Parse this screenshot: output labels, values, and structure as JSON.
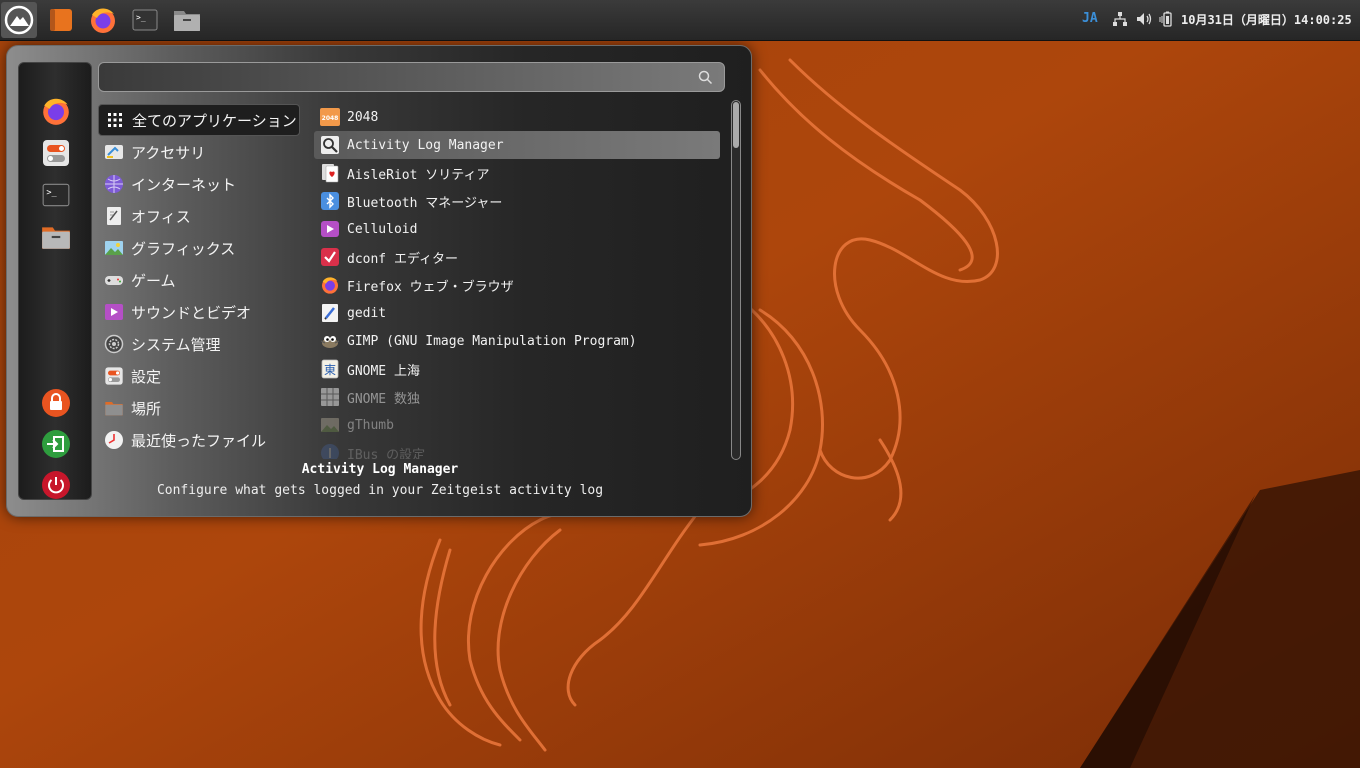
{
  "colors": {
    "wallpaper_base": "#b4490c",
    "wallpaper_line": "#e8753a",
    "panel_bg": "#2e2e2e",
    "accent_blue": "#3b8fd8",
    "menu_selected": "#6a6a6a"
  },
  "top_panel": {
    "launchers": [
      {
        "name": "ubuntu-mate-menu-icon"
      },
      {
        "name": "orange-app-icon"
      },
      {
        "name": "firefox-icon"
      },
      {
        "name": "terminal-icon"
      },
      {
        "name": "file-manager-icon"
      }
    ],
    "language": "JA",
    "network_icon": "network-wired-icon",
    "volume_icon": "speaker-icon",
    "battery_icon": "battery-icon",
    "clock": "10月31日（月曜日）14:00:25"
  },
  "menu": {
    "search": {
      "placeholder": "",
      "value": ""
    },
    "favorites": [
      {
        "icon": "firefox-icon"
      },
      {
        "icon": "settings-toggle-icon"
      },
      {
        "icon": "terminal-icon"
      },
      {
        "icon": "folder-icon"
      }
    ],
    "session": [
      {
        "icon": "lock-screen-icon",
        "color": "#e95420"
      },
      {
        "icon": "logout-icon",
        "color": "#2e9d3e"
      },
      {
        "icon": "power-icon",
        "color": "#c7162b"
      }
    ],
    "categories": [
      {
        "label": "全てのアプリケーション",
        "icon": "grid-icon"
      },
      {
        "label": "アクセサリ",
        "icon": "accessories-icon"
      },
      {
        "label": "インターネット",
        "icon": "internet-icon"
      },
      {
        "label": "オフィス",
        "icon": "office-icon"
      },
      {
        "label": "グラフィックス",
        "icon": "graphics-icon"
      },
      {
        "label": "ゲーム",
        "icon": "gamepad-icon"
      },
      {
        "label": "サウンドとビデオ",
        "icon": "multimedia-icon"
      },
      {
        "label": "システム管理",
        "icon": "system-gear-icon"
      },
      {
        "label": "設定",
        "icon": "settings-toggle-icon"
      },
      {
        "label": "場所",
        "icon": "folder-icon"
      },
      {
        "label": "最近使ったファイル",
        "icon": "recent-clock-icon"
      }
    ],
    "apps": [
      {
        "label": "2048",
        "icon": "2048-icon",
        "badge": "2048"
      },
      {
        "label": "Activity Log Manager",
        "icon": "activity-log-icon"
      },
      {
        "label": "AisleRiot ソリティア",
        "icon": "cards-icon"
      },
      {
        "label": "Bluetooth マネージャー",
        "icon": "bluetooth-icon"
      },
      {
        "label": "Celluloid",
        "icon": "celluloid-icon"
      },
      {
        "label": "dconf エディター",
        "icon": "dconf-icon"
      },
      {
        "label": "Firefox ウェブ・ブラウザ",
        "icon": "firefox-icon"
      },
      {
        "label": "gedit",
        "icon": "gedit-icon"
      },
      {
        "label": "GIMP (GNU Image Manipulation Program)",
        "icon": "gimp-icon"
      },
      {
        "label": "GNOME 上海",
        "icon": "mahjongg-icon",
        "badge": "東"
      },
      {
        "label": "GNOME 数独",
        "icon": "sudoku-icon"
      },
      {
        "label": "gThumb",
        "icon": "gthumb-icon"
      },
      {
        "label": "IBus の設定",
        "icon": "ibus-icon"
      }
    ],
    "description": {
      "title": "Activity Log Manager",
      "text": "Configure what gets logged in your Zeitgeist activity log"
    }
  }
}
